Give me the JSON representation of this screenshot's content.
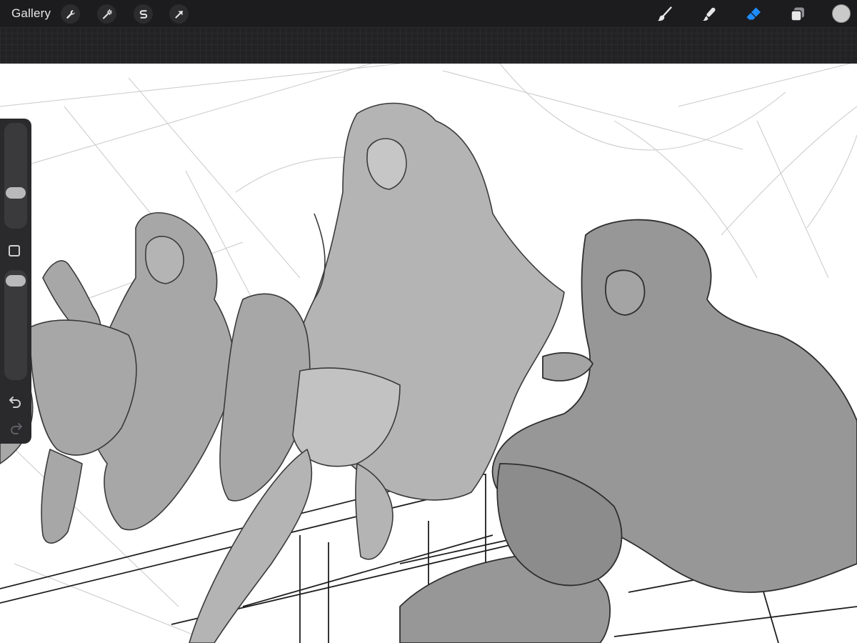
{
  "toolbar": {
    "gallery_label": "Gallery",
    "left_actions": [
      {
        "name": "actions",
        "icon": "wrench-icon"
      },
      {
        "name": "adjustments",
        "icon": "magic-wand-icon"
      },
      {
        "name": "selection",
        "icon": "selection-s-icon"
      },
      {
        "name": "transform",
        "icon": "arrow-cursor-icon"
      }
    ],
    "right_tools": [
      {
        "name": "brush",
        "icon": "brush-icon"
      },
      {
        "name": "smudge",
        "icon": "smudge-icon"
      },
      {
        "name": "eraser",
        "icon": "eraser-icon",
        "active": true
      },
      {
        "name": "layers",
        "icon": "layers-icon"
      }
    ],
    "active_tool_color": "#1e8cff",
    "current_color": "#c9c9c9"
  },
  "sidebar": {
    "brush_size": 0.32,
    "opacity": 0.95,
    "modify_icon": "square-icon",
    "undo_icon": "undo-icon",
    "redo_icon": "redo-icon"
  },
  "canvas": {
    "background": "#ffffff",
    "fill_tone": "#a7a7a7",
    "line_tone": "#3a3a3a"
  }
}
